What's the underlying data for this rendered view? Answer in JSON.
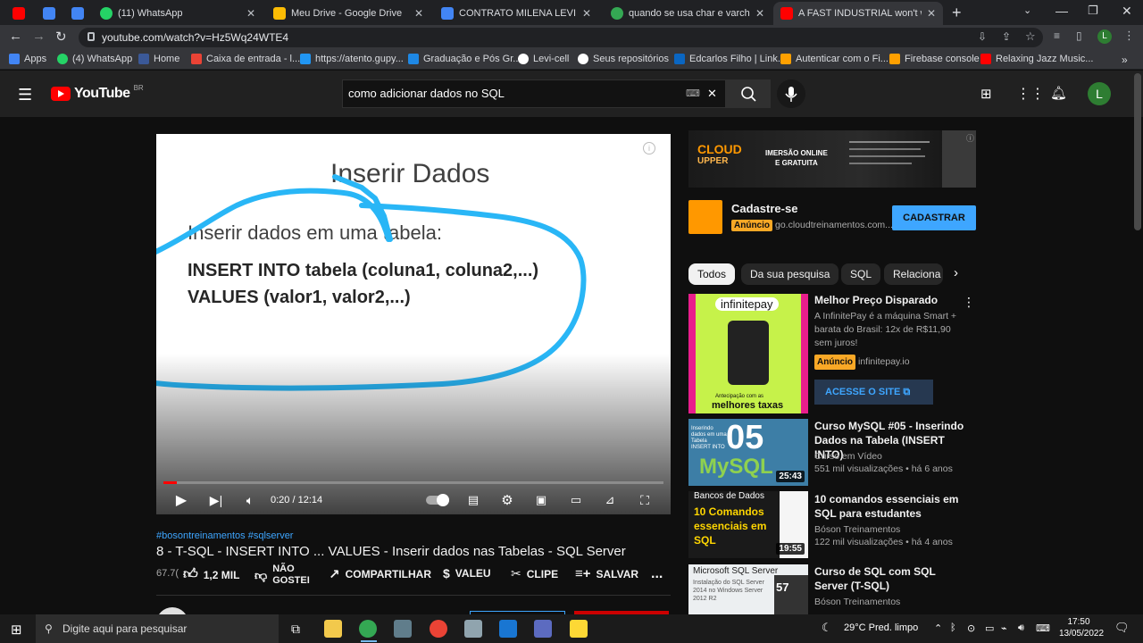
{
  "browser": {
    "tabs": [
      {
        "title": "",
        "color": "#ff0000"
      },
      {
        "title": "",
        "color": "#4285f4"
      },
      {
        "title": "",
        "color": "#4285f4"
      },
      {
        "title": "(11) WhatsApp",
        "color": "#25d366"
      },
      {
        "title": "Meu Drive - Google Drive",
        "color": "#fbbc04"
      },
      {
        "title": "CONTRATO MILENA LEVI - Docum",
        "color": "#4285f4"
      },
      {
        "title": "quando se usa char e varchar - P",
        "color": "#34a853"
      },
      {
        "title": "A FAST INDUSTRIAL won't wor",
        "color": "#ff0000"
      }
    ],
    "new_tab": "+",
    "url": "youtube.com/watch?v=Hz5Wq24WTE4",
    "bookmarks": [
      {
        "label": "Apps",
        "color": "#4285f4"
      },
      {
        "label": "(4) WhatsApp",
        "color": "#25d366"
      },
      {
        "label": "Home",
        "color": "#3b5998"
      },
      {
        "label": "Caixa de entrada - l...",
        "color": "#ea4335"
      },
      {
        "label": "https://atento.gupy...",
        "color": "#2196f3"
      },
      {
        "label": "Graduação e Pós Gr...",
        "color": "#1e88e5"
      },
      {
        "label": "Levi-cell",
        "color": "#ffffff"
      },
      {
        "label": "Seus repositórios",
        "color": "#ffffff"
      },
      {
        "label": "Edcarlos Filho | Link...",
        "color": "#0a66c2"
      },
      {
        "label": "Autenticar com o Fi...",
        "color": "#ffa000"
      },
      {
        "label": "Firebase console",
        "color": "#ffa000"
      },
      {
        "label": "Relaxing Jazz Music...",
        "color": "#ff0000"
      }
    ]
  },
  "youtube": {
    "logo": "YouTube",
    "region": "BR",
    "search_value": "como adicionar dados no SQL",
    "avatar_letter": "L",
    "avatar_color": "#2e7d32"
  },
  "video": {
    "slide_title": "Inserir Dados",
    "slide_subtitle": "Inserir dados em uma tabela:",
    "slide_code_line1": "INSERT INTO tabela (coluna1, coluna2,...)",
    "slide_code_line2": "VALUES (valor1, valor2,...)",
    "time": "0:20 / 12:14",
    "progress_fraction": 0.027,
    "hashtags": "#bosontreinamentos #sqlserver",
    "title": "8 - T-SQL - INSERT INTO ... VALUES - Inserir dados nas Tabelas - SQL Server",
    "views": "67.7(",
    "actions": {
      "likes": "1,2 MIL",
      "dislike_line1": "NÃO",
      "dislike_line2": "GOSTEI",
      "share": "COMPARTILHAR",
      "thanks": "VALEU",
      "clip": "CLIPE",
      "save": "SALVAR",
      "more": "..."
    }
  },
  "sidebar": {
    "ad_banner": {
      "brand_line1": "CLOUD",
      "brand_line2": "UPPER",
      "headline_line1": "IMERSÃO ONLINE",
      "headline_line2": "E GRATUITA"
    },
    "ad": {
      "title": "Cadastre-se",
      "badge": "Anúncio",
      "domain": "go.cloudtreinamentos.com...",
      "cta": "CADASTRAR"
    },
    "chips": [
      "Todos",
      "Da sua pesquisa",
      "SQL",
      "Relaciona"
    ],
    "promo": {
      "title": "Melhor Preço Disparado",
      "desc": "A InfinitePay é a máquina Smart + barata do Brasil: 12x de R$11,90 sem juros!",
      "badge": "Anúncio",
      "domain": "infinitepay.io",
      "cta": "ACESSE O SITE",
      "thumb_brand": "infinitepay",
      "thumb_caption": "melhores taxas",
      "thumb_caption_pre": "Antecipação com as"
    },
    "videos": [
      {
        "title": "Curso MySQL #05 - Inserindo Dados na Tabela (INSERT INTO)",
        "channel": "Curso em Vídeo",
        "stats": "551 mil visualizações • há 6 anos",
        "duration": "25:43",
        "thumb_text": "05",
        "thumb_sub": "MySQL",
        "thumb_small": "Inserindo dados em uma Tabela INSERT INTO"
      },
      {
        "title": "10 comandos essenciais em SQL para estudantes",
        "channel": "Bóson Treinamentos",
        "stats": "122 mil visualizações • há 4 anos",
        "duration": "19:55",
        "thumb_text": "10 Comandos essenciais em SQL",
        "thumb_small": "Bancos de Dados"
      },
      {
        "title": "Curso de SQL com SQL Server (T-SQL)",
        "channel": "Bóson Treinamentos",
        "stats": "",
        "duration": "57",
        "thumb_text": "Microsoft SQL Server",
        "thumb_small": "Instalação do SQL Server 2014 no Windows Server 2012 R2"
      }
    ]
  },
  "taskbar": {
    "search_placeholder": "Digite aqui para pesquisar",
    "weather": "29°C  Pred. limpo",
    "time": "17:50",
    "date": "13/05/2022"
  }
}
